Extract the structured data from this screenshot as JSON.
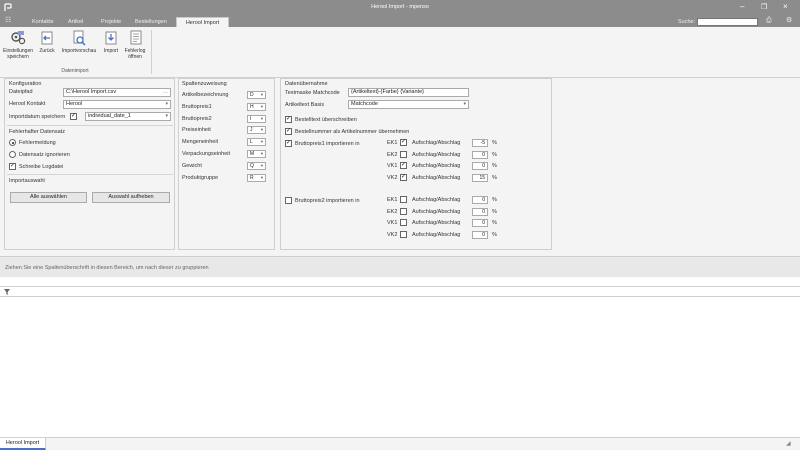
{
  "window": {
    "title": "Herool Import - mpenso"
  },
  "tabs": [
    {
      "label": "Kontakte"
    },
    {
      "label": "Artikel"
    },
    {
      "label": "Projekte"
    },
    {
      "label": "Bestellungen"
    },
    {
      "label": "Herool Import"
    }
  ],
  "search": {
    "label": "Suche:",
    "value": ""
  },
  "ribbon": {
    "buttons": [
      {
        "label1": "Einstellungen",
        "label2": "speichern"
      },
      {
        "label1": "Zurück",
        "label2": ""
      },
      {
        "label1": "Importvorschau",
        "label2": ""
      },
      {
        "label1": "Import",
        "label2": ""
      },
      {
        "label1": "Fehlerlog",
        "label2": "öffnen"
      }
    ],
    "group_label": "Datenimport"
  },
  "konfiguration": {
    "title": "Konfiguration",
    "datei_label": "Dateipfad",
    "datei_value": "C:\\Herool Import.csv",
    "kontakt_label": "Herool Kontakt",
    "kontakt_value": "Herool",
    "datum_label": "Importdatum speichern",
    "datum_checked": "✓",
    "datum_value": "individual_date_1"
  },
  "fehlerhaft": {
    "title": "Fehlerhafter Datensatz",
    "opt1": "Fehlermeldung",
    "opt2": "Datensatz ignorieren",
    "opt3": "Schreibe Logdatei",
    "opt3_checked": "✓"
  },
  "importauswahl": {
    "title": "Importauswahl",
    "btn_all": "Alle auswählen",
    "btn_clear": "Auswahl aufheben"
  },
  "spalten": {
    "title": "Spaltenzuweisung",
    "rows": [
      {
        "label": "Artikelbezeichnung",
        "value": "D"
      },
      {
        "label": "Bruttopreis1",
        "value": "H"
      },
      {
        "label": "Bruttopreis2",
        "value": "I"
      },
      {
        "label": "Preiseinheit",
        "value": "J"
      },
      {
        "label": "Mengeneinheit",
        "value": "L"
      },
      {
        "label": "Verpackungseinheit",
        "value": "M"
      },
      {
        "label": "Gewicht",
        "value": "Q"
      },
      {
        "label": "Produktgruppe",
        "value": "R"
      }
    ]
  },
  "datenuebernahme": {
    "title": "Datenübernahme",
    "matchcode_label": "Textmaske Matchcode",
    "matchcode_value": "{Artikeltext}-{Farbe} {Variante}",
    "basis_label": "Artikeltext Basis",
    "basis_value": "Matchcode",
    "check1": "Bestelltext überschreiben",
    "check1_mark": "✓",
    "check2": "Bestellnummer als Artikelnummer übernehmen",
    "check2_mark": "✓",
    "bp1_label": "Bruttopreis1 importieren in",
    "bp1_mark": "✓",
    "bp1_rows": [
      {
        "code": "EK1",
        "mark": "✓",
        "label": "Aufschlag/Abschlag",
        "value": "-5",
        "unit": "%"
      },
      {
        "code": "EK2",
        "mark": "",
        "label": "Aufschlag/Abschlag",
        "value": "0",
        "unit": "%"
      },
      {
        "code": "VK1",
        "mark": "✓",
        "label": "Aufschlag/Abschlag",
        "value": "0",
        "unit": "%"
      },
      {
        "code": "VK2",
        "mark": "✓",
        "label": "Aufschlag/Abschlag",
        "value": "15",
        "unit": "%"
      }
    ],
    "bp2_label": "Bruttopreis2 importieren in",
    "bp2_mark": "",
    "bp2_rows": [
      {
        "code": "EK1",
        "mark": "",
        "label": "Aufschlag/Abschlag",
        "value": "0",
        "unit": "%"
      },
      {
        "code": "EK2",
        "mark": "",
        "label": "Aufschlag/Abschlag",
        "value": "0",
        "unit": "%"
      },
      {
        "code": "VK1",
        "mark": "",
        "label": "Aufschlag/Abschlag",
        "value": "0",
        "unit": "%"
      },
      {
        "code": "VK2",
        "mark": "",
        "label": "Aufschlag/Abschlag",
        "value": "0",
        "unit": "%"
      }
    ]
  },
  "grid": {
    "group_hint": "Ziehen Sie eine Spaltenüberschrift in diesen Bereich, um nach dieser zu gruppieren"
  },
  "statusbar": {
    "tab": "Herool Import"
  }
}
